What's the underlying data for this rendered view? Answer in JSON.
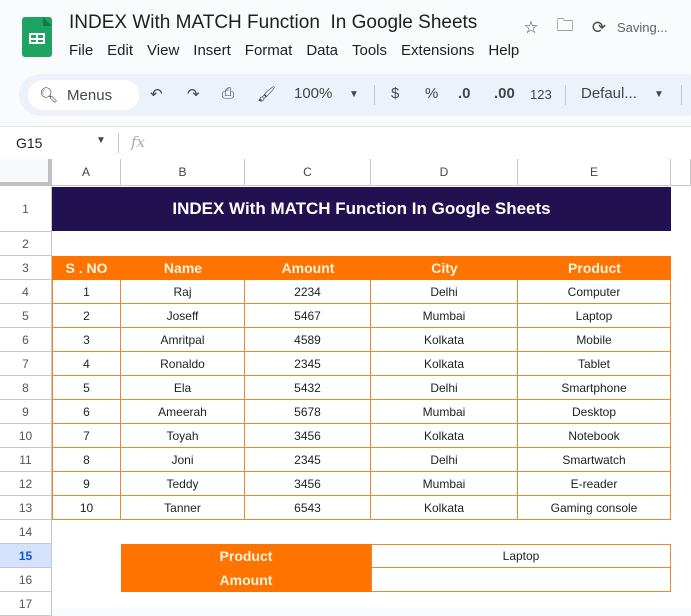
{
  "app": {
    "doc_title": "INDEX With MATCH Function  In Google Sheets",
    "status": "Saving...",
    "title_icons": [
      "star-icon",
      "move-folder-icon",
      "sync-icon"
    ]
  },
  "menu": [
    "File",
    "Edit",
    "View",
    "Insert",
    "Format",
    "Data",
    "Tools",
    "Extensions",
    "Help"
  ],
  "toolbar": {
    "search_label": "Menus",
    "zoom": "100%",
    "currency": "$",
    "percent": "%",
    "dec_decrease": ".0",
    "dec_increase": ".00",
    "number_format": "123",
    "font": "Defaul...",
    "undo_icon": "↶",
    "redo_icon": "↷",
    "print_icon": "⎙",
    "paint_icon": "🖌"
  },
  "formula_bar": {
    "name_box": "G15",
    "fx": "fx",
    "value": ""
  },
  "columns": [
    "A",
    "B",
    "C",
    "D",
    "E"
  ],
  "rows": [
    "1",
    "2",
    "3",
    "4",
    "5",
    "6",
    "7",
    "8",
    "9",
    "10",
    "11",
    "12",
    "13",
    "14",
    "15",
    "16",
    "17"
  ],
  "selected_row": "15",
  "sheet": {
    "title": "INDEX With MATCH Function  In Google Sheets",
    "headers": [
      "S . NO",
      "Name",
      "Amount",
      "City",
      "Product"
    ],
    "records": [
      [
        "1",
        "Raj",
        "2234",
        "Delhi",
        "Computer"
      ],
      [
        "2",
        "Joseff",
        "5467",
        "Mumbai",
        "Laptop"
      ],
      [
        "3",
        "Amritpal",
        "4589",
        "Kolkata",
        "Mobile"
      ],
      [
        "4",
        "Ronaldo",
        "2345",
        "Kolkata",
        "Tablet"
      ],
      [
        "5",
        "Ela",
        "5432",
        "Delhi",
        "Smartphone"
      ],
      [
        "6",
        "Ameerah",
        "5678",
        "Mumbai",
        "Desktop"
      ],
      [
        "7",
        "Toyah",
        "3456",
        "Kolkata",
        "Notebook"
      ],
      [
        "8",
        "Joni",
        "2345",
        "Delhi",
        "Smartwatch"
      ],
      [
        "9",
        "Teddy",
        "3456",
        "Mumbai",
        "E-reader"
      ],
      [
        "10",
        "Tanner",
        "6543",
        "Kolkata",
        "Gaming console"
      ]
    ],
    "lookup": {
      "product_label": "Product",
      "product_value": "Laptop",
      "amount_label": "Amount",
      "amount_value": ""
    }
  },
  "colors": {
    "title_band": "#211150",
    "header_orange": "#ff7300",
    "border_orange": "#e58a2e",
    "sheets_green": "#1ea362"
  }
}
